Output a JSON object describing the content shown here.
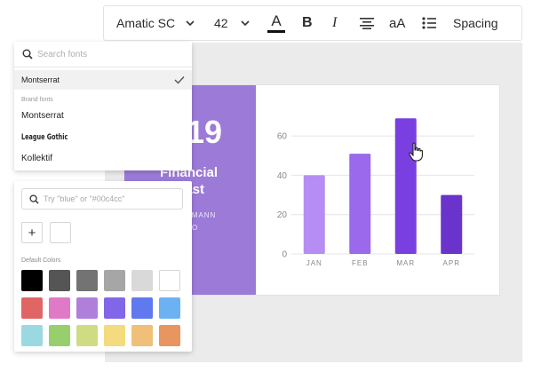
{
  "toolbar": {
    "font_name": "Amatic SC",
    "font_size": "42",
    "text_color_letter": "A",
    "bold_letter": "B",
    "italic_letter": "I",
    "case_label": "aA",
    "spacing_label": "Spacing"
  },
  "font_dropdown": {
    "search_placeholder": "Search fonts",
    "selected_font": "Montserrat",
    "section_label": "Brand fonts",
    "brand_fonts": [
      "Montserrat",
      "League Gothic",
      "Kollektif"
    ]
  },
  "color_picker": {
    "search_placeholder": "Try \"blue\" or \"#00c4cc\"",
    "add_label": "+",
    "section_label": "Default Colors",
    "colors": [
      "#000000",
      "#555555",
      "#737373",
      "#a6a6a6",
      "#d9d9d9",
      "#ffffff",
      "#e06666",
      "#e07ac7",
      "#b07fdc",
      "#8266e8",
      "#6079ee",
      "#6cb2f2",
      "#9ad9e1",
      "#98cf6d",
      "#cfdc83",
      "#f4db7f",
      "#f0bf7a",
      "#e8955f"
    ]
  },
  "design": {
    "year_fragment": "19",
    "title_line1": "Financial",
    "title_line2": "cast",
    "author_line1": "FFMANN",
    "author_line2": "O"
  },
  "chart_data": {
    "type": "bar",
    "categories": [
      "JAN",
      "FEB",
      "MAR",
      "APR"
    ],
    "values": [
      40,
      51,
      69,
      30
    ],
    "ylim": [
      0,
      70
    ],
    "yticks": [
      0,
      20,
      40,
      60
    ],
    "colors": [
      "#b68df2",
      "#9a69ec",
      "#7a3fe0",
      "#6a33cc"
    ],
    "grid": true
  }
}
